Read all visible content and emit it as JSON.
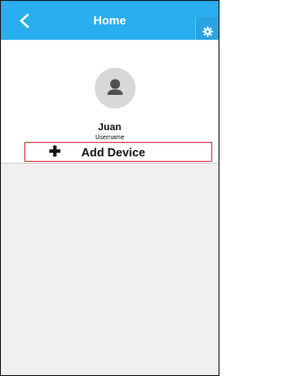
{
  "header": {
    "title": "Home",
    "back_icon": "chevron-left-icon",
    "settings_icon": "gear-icon",
    "accent_color": "#2aaef0"
  },
  "profile": {
    "avatar_icon": "user-icon",
    "name": "Juan",
    "name_label": "Username"
  },
  "actions": {
    "add_device_icon": "plus-icon",
    "add_device_label": "Add Device",
    "add_device_border_color": "#d93a3a"
  }
}
